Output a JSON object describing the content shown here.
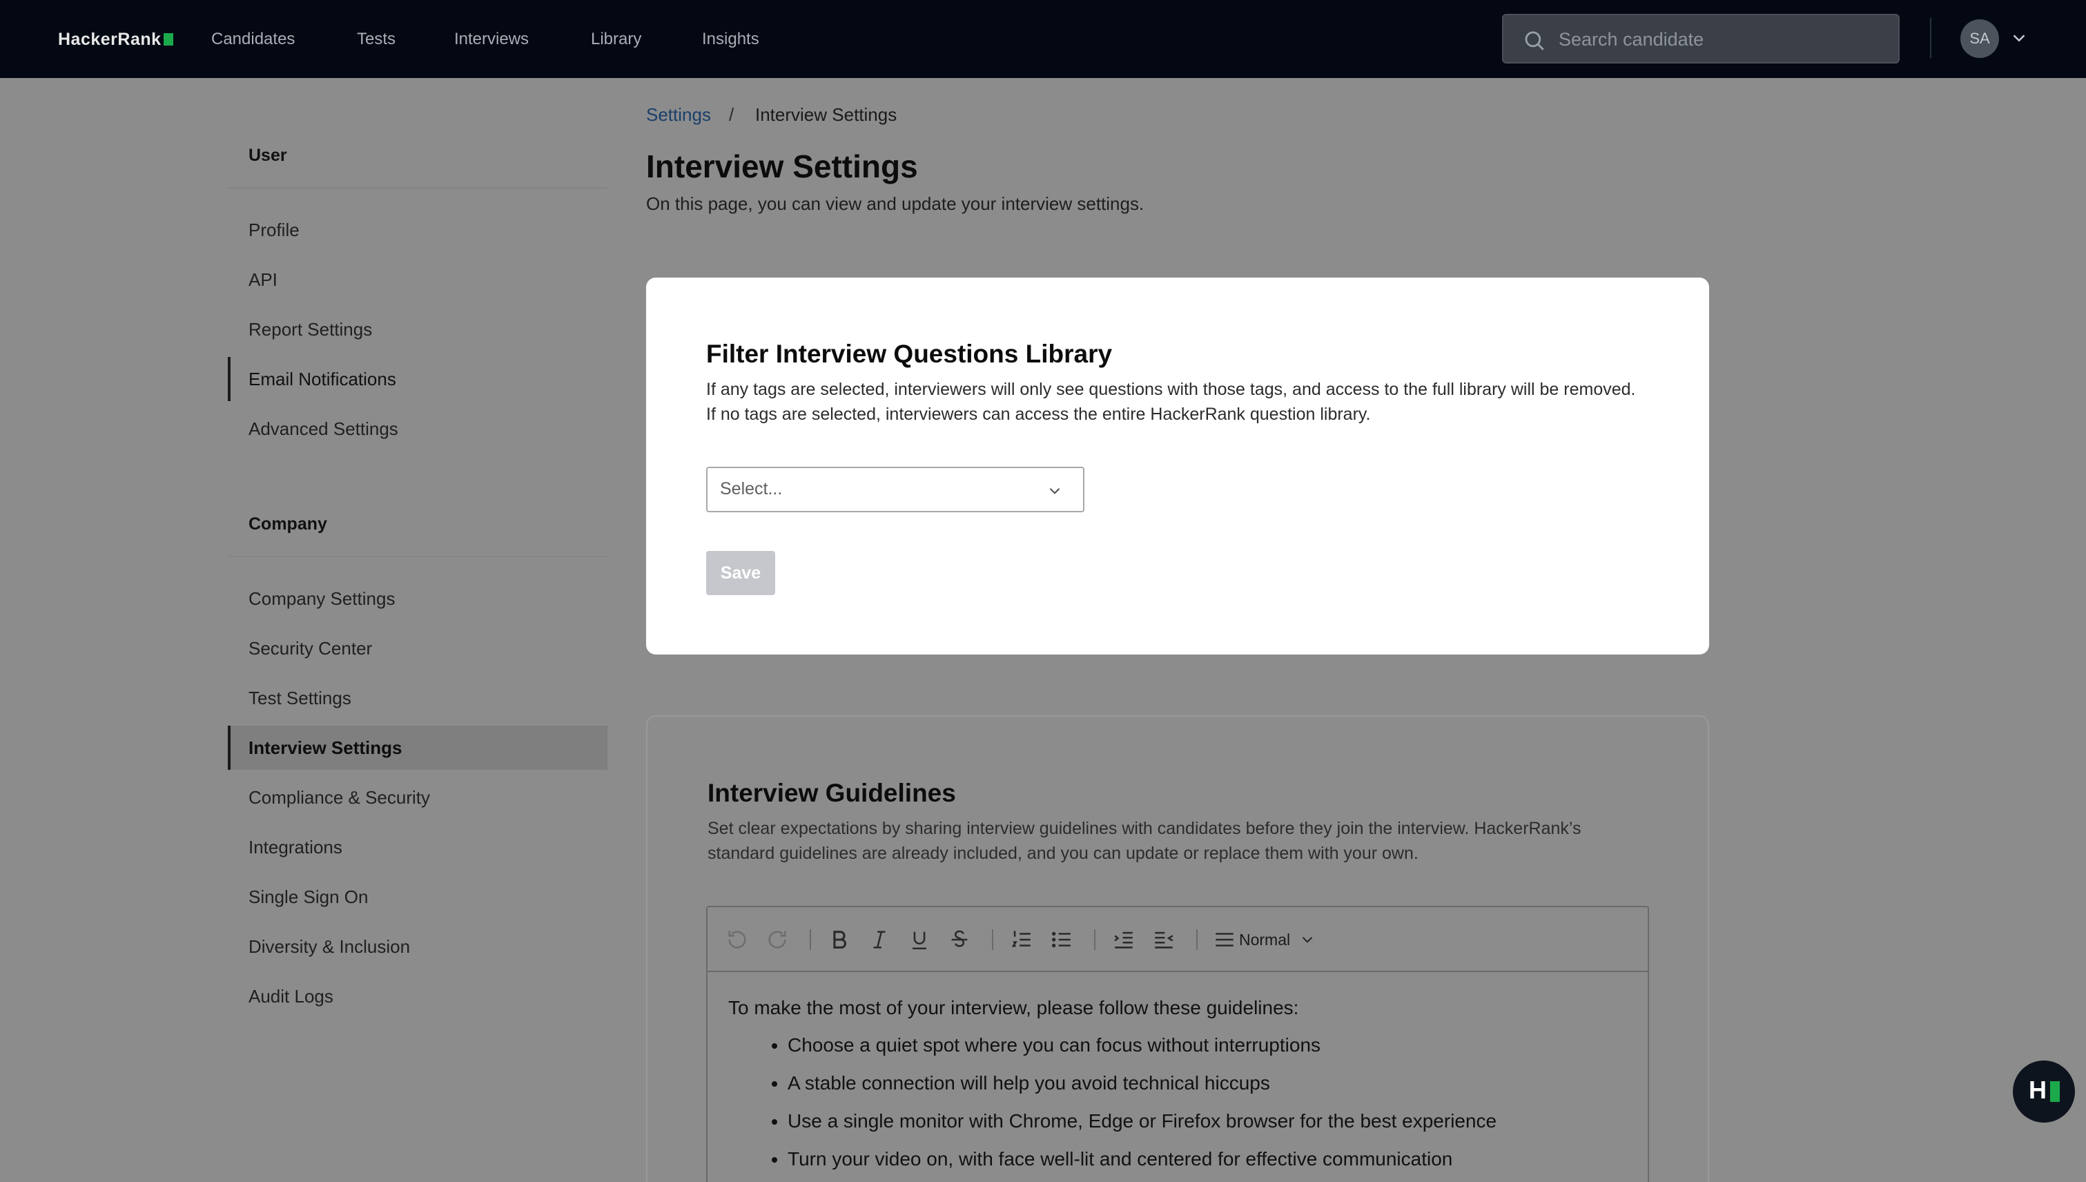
{
  "app": {
    "logo": "HackerRank"
  },
  "nav": [
    "Candidates",
    "Tests",
    "Interviews",
    "Library",
    "Insights"
  ],
  "search": {
    "placeholder": "Search candidate"
  },
  "user": {
    "initials": "SA"
  },
  "sidebar": {
    "user_heading": "User",
    "user_items": [
      "Profile",
      "API",
      "Report Settings",
      "Email Notifications",
      "Advanced Settings"
    ],
    "company_heading": "Company",
    "company_items": [
      "Company Settings",
      "Security Center",
      "Test Settings",
      "Interview Settings",
      "Compliance & Security",
      "Integrations",
      "Single Sign On",
      "Diversity & Inclusion",
      "Audit Logs"
    ]
  },
  "breadcrumb": {
    "parent": "Settings",
    "separator": "/",
    "current": "Interview Settings"
  },
  "page": {
    "title": "Interview Settings",
    "subtitle": "On this page, you can view and update your interview settings."
  },
  "filter_card": {
    "title": "Filter Interview Questions Library",
    "description": "If any tags are selected, interviewers will only see questions with those tags, and access to the full library will be removed. If no tags are selected, interviewers can access the entire HackerRank question library.",
    "select_placeholder": "Select...",
    "save_label": "Save"
  },
  "guidelines_card": {
    "title": "Interview Guidelines",
    "description": "Set clear expectations by sharing interview guidelines with candidates before they join the interview. HackerRank’s standard guidelines are already included, and you can update or replace them with your own.",
    "toolbar": {
      "block_style": "Normal"
    },
    "editor": {
      "intro": "To make the most of your interview, please follow these guidelines:",
      "items": [
        "Choose a quiet spot where you can focus without interruptions",
        "A stable connection will help you avoid technical hiccups",
        "Use a single monitor with Chrome, Edge or Firefox browser for the best experience",
        "Turn your video on, with face well-lit and centered for effective communication"
      ]
    }
  },
  "help": {
    "label": "H"
  }
}
